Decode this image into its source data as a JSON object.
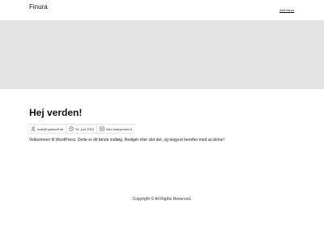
{
  "header": {
    "site_title": "Finura",
    "menu_link": "Add Menu"
  },
  "post": {
    "title": "Hej verden!",
    "author": "mail@hpabsoft.dk",
    "date": "26. juni 2019",
    "category": "Ikke-kategoriseret",
    "content": "Velkommen til WordPress. Dette er dit første indlæg. Redigér eller slet det, og begynd herefter med at skrive!"
  },
  "footer": {
    "copyright": "Copyright © All Rights Reserved."
  }
}
